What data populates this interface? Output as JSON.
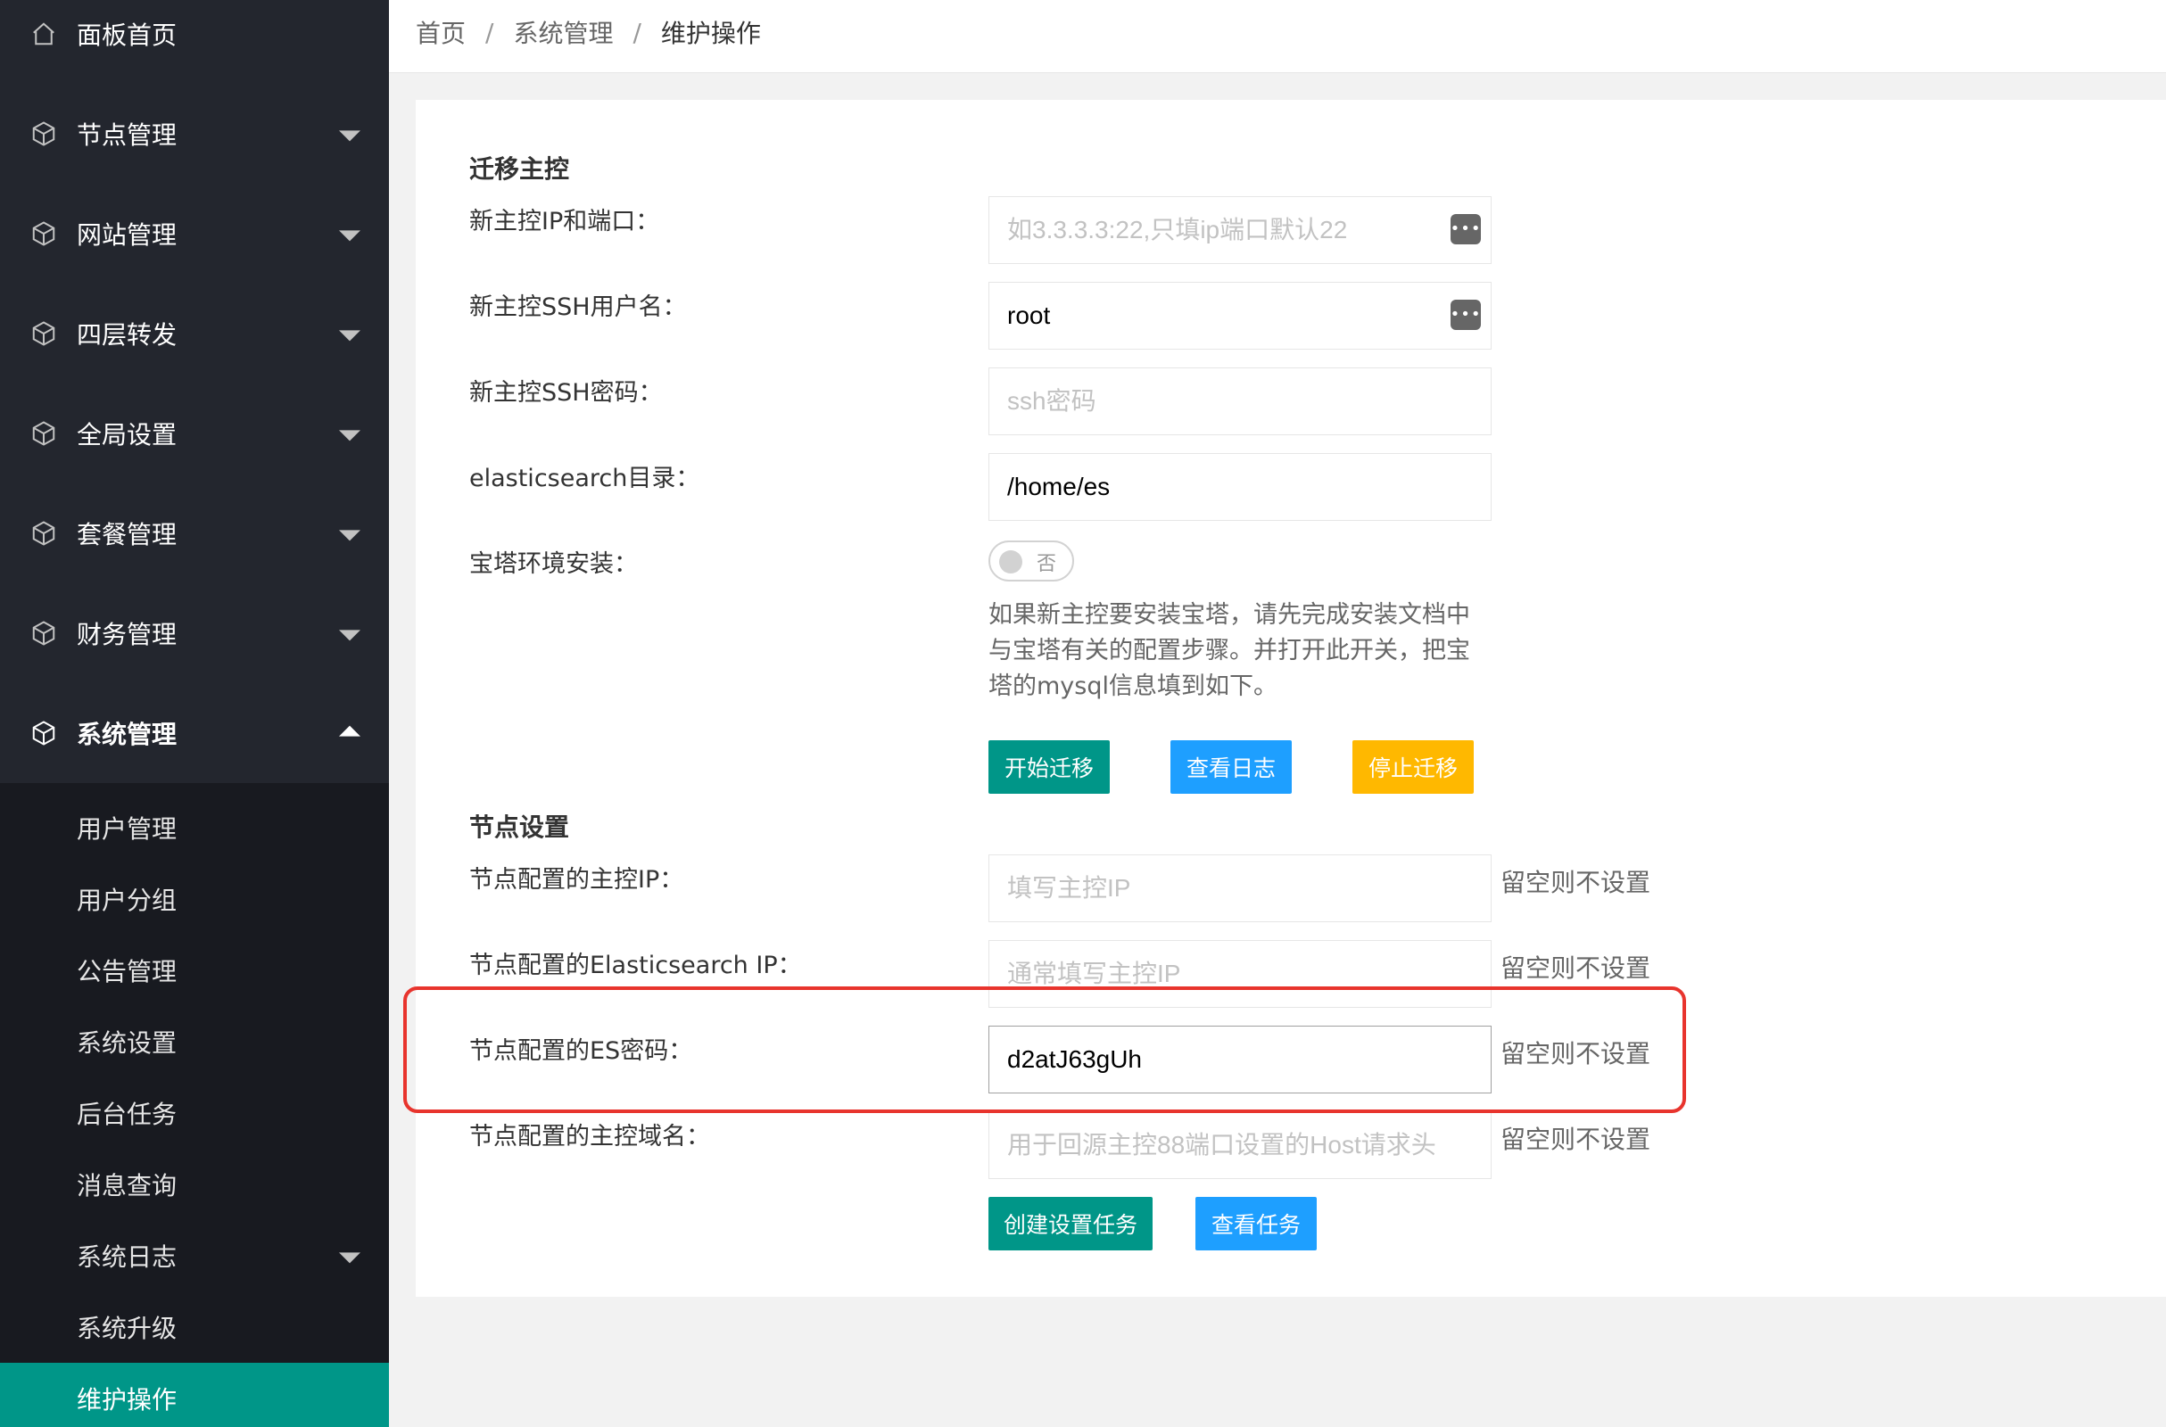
{
  "sidebar": {
    "home": "面板首页",
    "items": [
      {
        "label": "节点管理"
      },
      {
        "label": "网站管理"
      },
      {
        "label": "四层转发"
      },
      {
        "label": "全局设置"
      },
      {
        "label": "套餐管理"
      },
      {
        "label": "财务管理"
      },
      {
        "label": "系统管理"
      }
    ],
    "submenu": [
      {
        "label": "用户管理"
      },
      {
        "label": "用户分组"
      },
      {
        "label": "公告管理"
      },
      {
        "label": "系统设置"
      },
      {
        "label": "后台任务"
      },
      {
        "label": "消息查询"
      },
      {
        "label": "系统日志"
      },
      {
        "label": "系统升级"
      },
      {
        "label": "维护操作"
      }
    ]
  },
  "breadcrumb": {
    "items": [
      "首页",
      "系统管理",
      "维护操作"
    ],
    "separator": "/"
  },
  "migrate": {
    "title": "迁移主控",
    "ip_label": "新主控IP和端口：",
    "ip_placeholder": "如3.3.3.3:22,只填ip端口默认22",
    "ip_value": "",
    "user_label": "新主控SSH用户名：",
    "user_value": "root",
    "pass_label": "新主控SSH密码：",
    "pass_placeholder": "ssh密码",
    "es_dir_label": "elasticsearch目录：",
    "es_dir_value": "/home/es",
    "bt_label": "宝塔环境安装：",
    "bt_switch_text": "否",
    "bt_switch_on": false,
    "tip": "如果新主控要安装宝塔，请先完成安装文档中与宝塔有关的配置步骤。并打开此开关，把宝塔的mysql信息填到如下。",
    "btn_start": "开始迁移",
    "btn_log": "查看日志",
    "btn_stop": "停止迁移"
  },
  "node": {
    "title": "节点设置",
    "master_ip_label": "节点配置的主控IP：",
    "master_ip_placeholder": "填写主控IP",
    "es_ip_label": "节点配置的Elasticsearch IP：",
    "es_ip_placeholder": "通常填写主控IP",
    "es_pass_label": "节点配置的ES密码：",
    "es_pass_value": "d2atJ63gUh",
    "domain_label": "节点配置的主控域名：",
    "domain_placeholder": "用于回源主控88端口设置的Host请求头",
    "empty_hint": "留空则不设置",
    "btn_create": "创建设置任务",
    "btn_view": "查看任务"
  },
  "colors": {
    "sidebar_bg": "#23262e",
    "submenu_bg": "#181a20",
    "active": "#009688",
    "blue": "#1e9fff",
    "orange": "#ffb800",
    "highlight": "#e8342d"
  }
}
